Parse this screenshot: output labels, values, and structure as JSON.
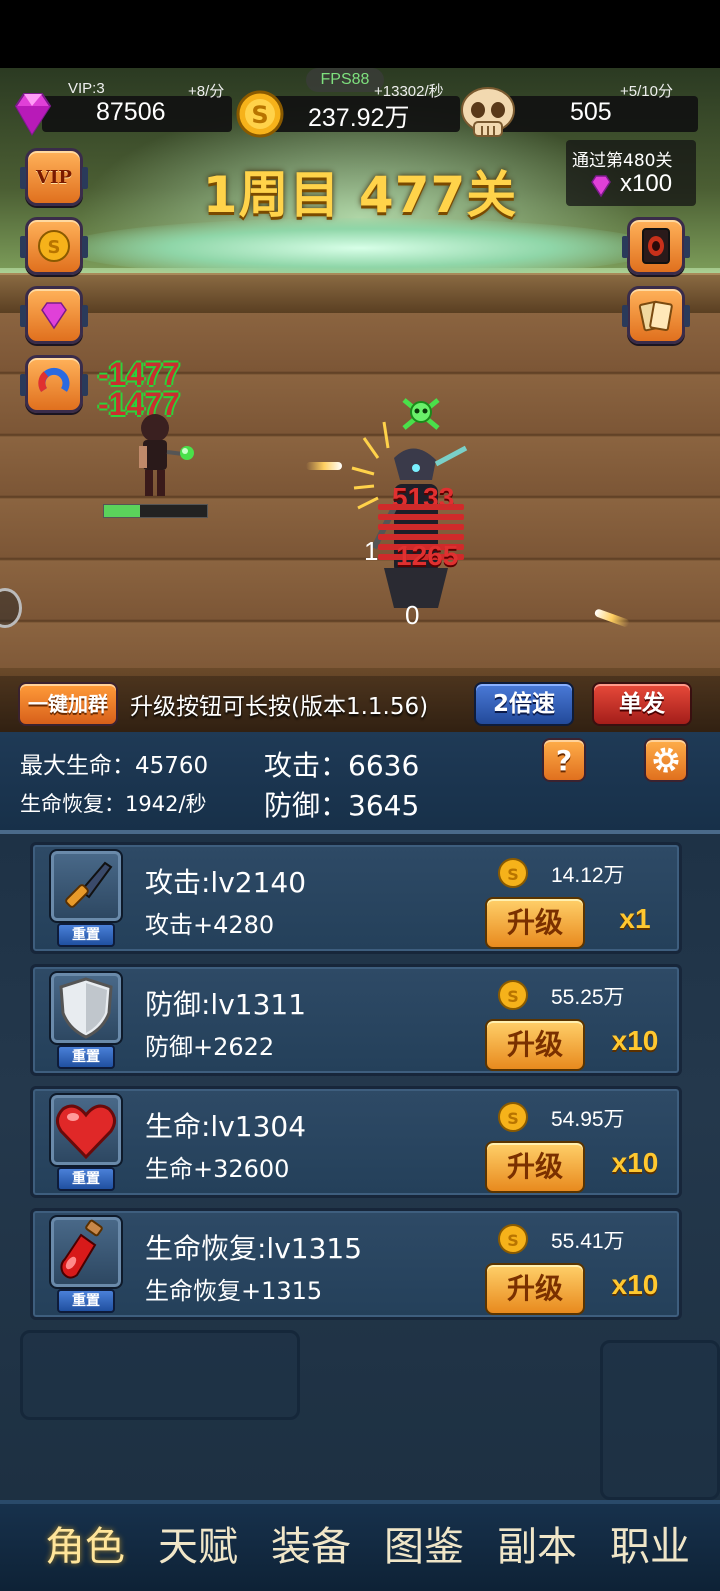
{
  "resources": {
    "vip_label": "VIP:3",
    "gems": "87506",
    "gems_rate": "+8/分",
    "gold": "237.92万",
    "gold_rate": "+13302/秒",
    "skulls": "505",
    "skulls_rate": "+5/10分",
    "fps": "FPS88"
  },
  "stage": {
    "title": "1周目 477关",
    "reward_title": "通过第480关",
    "reward_amount": "x100"
  },
  "side_buttons": {
    "vip": "VIP"
  },
  "battle": {
    "hero_damage_1": "-1477",
    "hero_damage_2": "-1477",
    "enemy_damage_1": "5133",
    "enemy_damage_2": "1265",
    "floating_1": "1",
    "floating_0": "0",
    "hero_hp_ratio": 0.35
  },
  "announcement": {
    "join_group": "一键加群",
    "text": "升级按钮可长按(版本1.1.56)",
    "speed": "2倍速",
    "single": "单发"
  },
  "stats": {
    "max_hp": "最大生命：45760",
    "regen": "生命恢复：1942/秒",
    "attack": "攻击：6636",
    "defense": "防御：3645",
    "help": "?"
  },
  "upgrades": [
    {
      "name": "攻击:lv2140",
      "desc": "攻击+4280",
      "price": "14.12万",
      "button": "升级",
      "multiplier": "x1",
      "reset": "重置",
      "icon": "knife-icon"
    },
    {
      "name": "防御:lv1311",
      "desc": "防御+2622",
      "price": "55.25万",
      "button": "升级",
      "multiplier": "x10",
      "reset": "重置",
      "icon": "shield-icon"
    },
    {
      "name": "生命:lv1304",
      "desc": "生命+32600",
      "price": "54.95万",
      "button": "升级",
      "multiplier": "x10",
      "reset": "重置",
      "icon": "heart-icon"
    },
    {
      "name": "生命恢复:lv1315",
      "desc": "生命恢复+1315",
      "price": "55.41万",
      "button": "升级",
      "multiplier": "x10",
      "reset": "重置",
      "icon": "potion-icon"
    }
  ],
  "nav": {
    "tabs": [
      "角色",
      "天赋",
      "装备",
      "图鉴",
      "副本",
      "职业"
    ],
    "active": "角色"
  },
  "colors": {
    "gold_text": "#ffd34a",
    "panel_bg": "#2a3e52",
    "button_orange": "#e0701e",
    "button_blue": "#234a9a"
  }
}
